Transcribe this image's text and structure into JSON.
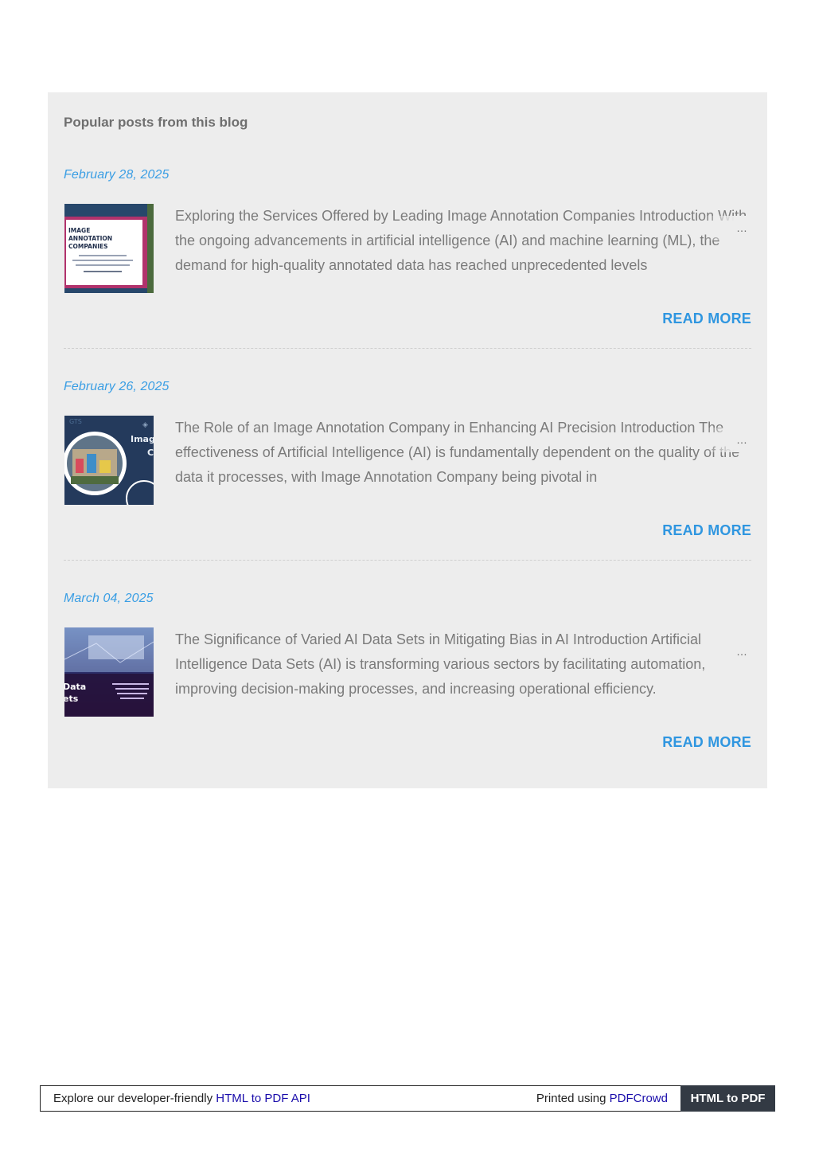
{
  "popular_posts": {
    "heading": "Popular posts from this blog",
    "ellipsis": "…",
    "posts": [
      {
        "date": "February 28, 2025",
        "snippet": "Exploring the Services Offered by Leading Image Annotation Companies Introduction With the ongoing advancements in artificial intelligence (AI) and machine learning (ML), the demand for high-quality annotated data has reached unprecedented levels",
        "read_more": "READ MORE",
        "thumb_text": "IMAGE ANNOTATION COMPANIES"
      },
      {
        "date": "February 26, 2025",
        "snippet": "The Role of an Image Annotation Company in Enhancing AI Precision Introduction The effectiveness of Artificial Intelligence (AI) is fundamentally dependent on the quality of the data it processes, with Image Annotation Company being pivotal in",
        "read_more": "READ MORE",
        "thumb_text": "Imag"
      },
      {
        "date": "March 04, 2025",
        "snippet": "The Significance of Varied AI Data Sets in Mitigating Bias in AI Introduction Artificial Intelligence Data Sets (AI) is transforming various sectors by facilitating automation, improving decision-making processes, and increasing operational efficiency.",
        "read_more": "READ MORE",
        "thumb_text": "Data Sets"
      }
    ]
  },
  "footer": {
    "left_prefix": "Explore our developer-friendly ",
    "left_link": "HTML to PDF API",
    "right_prefix": "Printed using ",
    "right_link": "PDFCrowd",
    "badge": "HTML to PDF"
  },
  "colors": {
    "panel_bg": "#ededed",
    "accent": "#2f96e0",
    "date": "#3a9ee4",
    "snippet": "#7b7b7b",
    "badge_bg": "#333a44"
  }
}
